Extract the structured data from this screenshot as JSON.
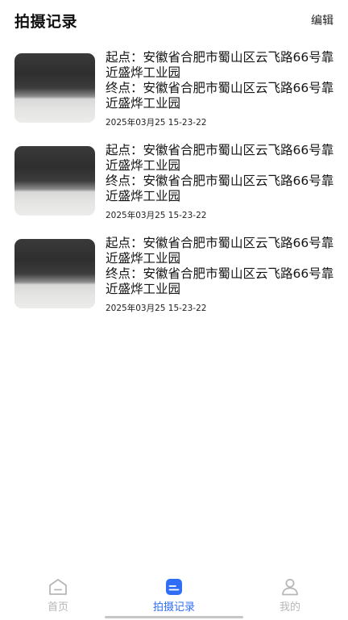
{
  "header": {
    "title": "拍摄记录",
    "edit_label": "编辑"
  },
  "records": [
    {
      "start": "起点：安徽省合肥市蜀山区云飞路66号靠近盛烨工业园",
      "end": "终点：安徽省合肥市蜀山区云飞路66号靠近盛烨工业园",
      "time": "2025年03月25 15-23-22"
    },
    {
      "start": "起点：安徽省合肥市蜀山区云飞路66号靠近盛烨工业园",
      "end": "终点：安徽省合肥市蜀山区云飞路66号靠近盛烨工业园",
      "time": "2025年03月25 15-23-22"
    },
    {
      "start": "起点：安徽省合肥市蜀山区云飞路66号靠近盛烨工业园",
      "end": "终点：安徽省合肥市蜀山区云飞路66号靠近盛烨工业园",
      "time": "2025年03月25 15-23-22"
    }
  ],
  "tabbar": {
    "items": [
      {
        "label": "首页",
        "icon": "home-icon",
        "active": false
      },
      {
        "label": "拍摄记录",
        "icon": "record-icon",
        "active": true
      },
      {
        "label": "我的",
        "icon": "profile-icon",
        "active": false
      }
    ]
  },
  "colors": {
    "accent": "#2f6df6",
    "inactive": "#b7b7b7"
  }
}
